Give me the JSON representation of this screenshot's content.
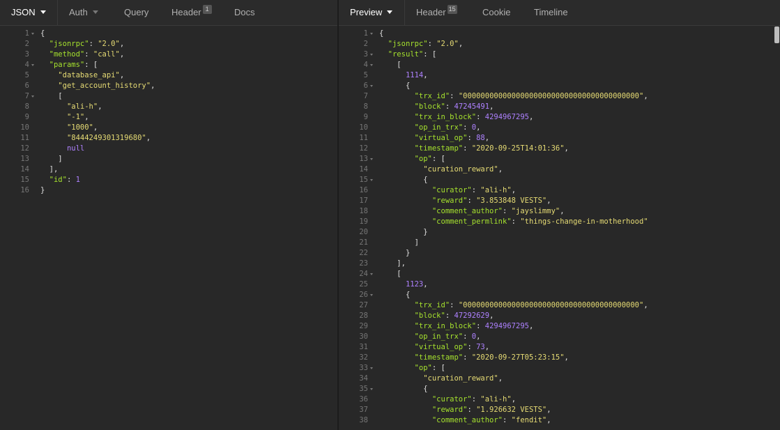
{
  "request_tabs": [
    {
      "label": "JSON",
      "dropdown": true,
      "active": true
    },
    {
      "label": "Auth",
      "dropdown": true
    },
    {
      "label": "Query"
    },
    {
      "label": "Header",
      "badge": "1"
    },
    {
      "label": "Docs"
    }
  ],
  "response_tabs": [
    {
      "label": "Preview",
      "dropdown": true,
      "active": true
    },
    {
      "label": "Header",
      "badge": "15"
    },
    {
      "label": "Cookie"
    },
    {
      "label": "Timeline"
    }
  ],
  "colors": {
    "key": "#a6e22e",
    "string": "#e6db74",
    "number": "#ae81ff",
    "punctuation": "#e0e0e0",
    "line_number": "#767676",
    "background": "#282828"
  },
  "request_lines": [
    {
      "n": "1",
      "fold": true,
      "t": [
        [
          "p",
          "{"
        ]
      ]
    },
    {
      "n": "2",
      "t": [
        [
          "w",
          "  "
        ],
        [
          "k",
          "\"jsonrpc\""
        ],
        [
          "p",
          ": "
        ],
        [
          "s",
          "\"2.0\""
        ],
        [
          "p",
          ","
        ]
      ]
    },
    {
      "n": "3",
      "t": [
        [
          "w",
          "  "
        ],
        [
          "k",
          "\"method\""
        ],
        [
          "p",
          ": "
        ],
        [
          "s",
          "\"call\""
        ],
        [
          "p",
          ","
        ]
      ]
    },
    {
      "n": "4",
      "fold": true,
      "t": [
        [
          "w",
          "  "
        ],
        [
          "k",
          "\"params\""
        ],
        [
          "p",
          ": ["
        ]
      ]
    },
    {
      "n": "5",
      "t": [
        [
          "w",
          "    "
        ],
        [
          "s",
          "\"database_api\""
        ],
        [
          "p",
          ","
        ]
      ]
    },
    {
      "n": "6",
      "t": [
        [
          "w",
          "    "
        ],
        [
          "s",
          "\"get_account_history\""
        ],
        [
          "p",
          ","
        ]
      ]
    },
    {
      "n": "7",
      "fold": true,
      "t": [
        [
          "w",
          "    "
        ],
        [
          "p",
          "["
        ]
      ]
    },
    {
      "n": "8",
      "t": [
        [
          "w",
          "      "
        ],
        [
          "s",
          "\"ali-h\""
        ],
        [
          "p",
          ","
        ]
      ]
    },
    {
      "n": "9",
      "t": [
        [
          "w",
          "      "
        ],
        [
          "s",
          "\"-1\""
        ],
        [
          "p",
          ","
        ]
      ]
    },
    {
      "n": "10",
      "t": [
        [
          "w",
          "      "
        ],
        [
          "s",
          "\"1000\""
        ],
        [
          "p",
          ","
        ]
      ]
    },
    {
      "n": "11",
      "t": [
        [
          "w",
          "      "
        ],
        [
          "s",
          "\"8444249301319680\""
        ],
        [
          "p",
          ","
        ]
      ]
    },
    {
      "n": "12",
      "t": [
        [
          "w",
          "      "
        ],
        [
          "n",
          "null"
        ]
      ]
    },
    {
      "n": "13",
      "t": [
        [
          "w",
          "    "
        ],
        [
          "p",
          "]"
        ]
      ]
    },
    {
      "n": "14",
      "t": [
        [
          "w",
          "  "
        ],
        [
          "p",
          "],"
        ]
      ]
    },
    {
      "n": "15",
      "t": [
        [
          "w",
          "  "
        ],
        [
          "k",
          "\"id\""
        ],
        [
          "p",
          ": "
        ],
        [
          "n",
          "1"
        ]
      ]
    },
    {
      "n": "16",
      "t": [
        [
          "p",
          "}"
        ]
      ]
    }
  ],
  "response_lines": [
    {
      "n": "1",
      "fold": true,
      "t": [
        [
          "p",
          "{"
        ]
      ]
    },
    {
      "n": "2",
      "t": [
        [
          "w",
          "  "
        ],
        [
          "k",
          "\"jsonrpc\""
        ],
        [
          "p",
          ": "
        ],
        [
          "s",
          "\"2.0\""
        ],
        [
          "p",
          ","
        ]
      ]
    },
    {
      "n": "3",
      "fold": true,
      "t": [
        [
          "w",
          "  "
        ],
        [
          "k",
          "\"result\""
        ],
        [
          "p",
          ": ["
        ]
      ]
    },
    {
      "n": "4",
      "fold": true,
      "t": [
        [
          "w",
          "    "
        ],
        [
          "p",
          "["
        ]
      ]
    },
    {
      "n": "5",
      "t": [
        [
          "w",
          "      "
        ],
        [
          "n",
          "1114"
        ],
        [
          "p",
          ","
        ]
      ]
    },
    {
      "n": "6",
      "fold": true,
      "t": [
        [
          "w",
          "      "
        ],
        [
          "p",
          "{"
        ]
      ]
    },
    {
      "n": "7",
      "t": [
        [
          "w",
          "        "
        ],
        [
          "k",
          "\"trx_id\""
        ],
        [
          "p",
          ": "
        ],
        [
          "s",
          "\"0000000000000000000000000000000000000000\""
        ],
        [
          "p",
          ","
        ]
      ]
    },
    {
      "n": "8",
      "t": [
        [
          "w",
          "        "
        ],
        [
          "k",
          "\"block\""
        ],
        [
          "p",
          ": "
        ],
        [
          "n",
          "47245491"
        ],
        [
          "p",
          ","
        ]
      ]
    },
    {
      "n": "9",
      "t": [
        [
          "w",
          "        "
        ],
        [
          "k",
          "\"trx_in_block\""
        ],
        [
          "p",
          ": "
        ],
        [
          "n",
          "4294967295"
        ],
        [
          "p",
          ","
        ]
      ]
    },
    {
      "n": "10",
      "t": [
        [
          "w",
          "        "
        ],
        [
          "k",
          "\"op_in_trx\""
        ],
        [
          "p",
          ": "
        ],
        [
          "n",
          "0"
        ],
        [
          "p",
          ","
        ]
      ]
    },
    {
      "n": "11",
      "t": [
        [
          "w",
          "        "
        ],
        [
          "k",
          "\"virtual_op\""
        ],
        [
          "p",
          ": "
        ],
        [
          "n",
          "88"
        ],
        [
          "p",
          ","
        ]
      ]
    },
    {
      "n": "12",
      "t": [
        [
          "w",
          "        "
        ],
        [
          "k",
          "\"timestamp\""
        ],
        [
          "p",
          ": "
        ],
        [
          "s",
          "\"2020-09-25T14:01:36\""
        ],
        [
          "p",
          ","
        ]
      ]
    },
    {
      "n": "13",
      "fold": true,
      "t": [
        [
          "w",
          "        "
        ],
        [
          "k",
          "\"op\""
        ],
        [
          "p",
          ": ["
        ]
      ]
    },
    {
      "n": "14",
      "t": [
        [
          "w",
          "          "
        ],
        [
          "s",
          "\"curation_reward\""
        ],
        [
          "p",
          ","
        ]
      ]
    },
    {
      "n": "15",
      "fold": true,
      "t": [
        [
          "w",
          "          "
        ],
        [
          "p",
          "{"
        ]
      ]
    },
    {
      "n": "16",
      "t": [
        [
          "w",
          "            "
        ],
        [
          "k",
          "\"curator\""
        ],
        [
          "p",
          ": "
        ],
        [
          "s",
          "\"ali-h\""
        ],
        [
          "p",
          ","
        ]
      ]
    },
    {
      "n": "17",
      "t": [
        [
          "w",
          "            "
        ],
        [
          "k",
          "\"reward\""
        ],
        [
          "p",
          ": "
        ],
        [
          "s",
          "\"3.853848 VESTS\""
        ],
        [
          "p",
          ","
        ]
      ]
    },
    {
      "n": "18",
      "t": [
        [
          "w",
          "            "
        ],
        [
          "k",
          "\"comment_author\""
        ],
        [
          "p",
          ": "
        ],
        [
          "s",
          "\"jayslimmy\""
        ],
        [
          "p",
          ","
        ]
      ]
    },
    {
      "n": "19",
      "t": [
        [
          "w",
          "            "
        ],
        [
          "k",
          "\"comment_permlink\""
        ],
        [
          "p",
          ": "
        ],
        [
          "s",
          "\"things-change-in-motherhood\""
        ]
      ]
    },
    {
      "n": "20",
      "t": [
        [
          "w",
          "          "
        ],
        [
          "p",
          "}"
        ]
      ]
    },
    {
      "n": "21",
      "t": [
        [
          "w",
          "        "
        ],
        [
          "p",
          "]"
        ]
      ]
    },
    {
      "n": "22",
      "t": [
        [
          "w",
          "      "
        ],
        [
          "p",
          "}"
        ]
      ]
    },
    {
      "n": "23",
      "t": [
        [
          "w",
          "    "
        ],
        [
          "p",
          "],"
        ]
      ]
    },
    {
      "n": "24",
      "fold": true,
      "t": [
        [
          "w",
          "    "
        ],
        [
          "p",
          "["
        ]
      ]
    },
    {
      "n": "25",
      "t": [
        [
          "w",
          "      "
        ],
        [
          "n",
          "1123"
        ],
        [
          "p",
          ","
        ]
      ]
    },
    {
      "n": "26",
      "fold": true,
      "t": [
        [
          "w",
          "      "
        ],
        [
          "p",
          "{"
        ]
      ]
    },
    {
      "n": "27",
      "t": [
        [
          "w",
          "        "
        ],
        [
          "k",
          "\"trx_id\""
        ],
        [
          "p",
          ": "
        ],
        [
          "s",
          "\"0000000000000000000000000000000000000000\""
        ],
        [
          "p",
          ","
        ]
      ]
    },
    {
      "n": "28",
      "t": [
        [
          "w",
          "        "
        ],
        [
          "k",
          "\"block\""
        ],
        [
          "p",
          ": "
        ],
        [
          "n",
          "47292629"
        ],
        [
          "p",
          ","
        ]
      ]
    },
    {
      "n": "29",
      "t": [
        [
          "w",
          "        "
        ],
        [
          "k",
          "\"trx_in_block\""
        ],
        [
          "p",
          ": "
        ],
        [
          "n",
          "4294967295"
        ],
        [
          "p",
          ","
        ]
      ]
    },
    {
      "n": "30",
      "t": [
        [
          "w",
          "        "
        ],
        [
          "k",
          "\"op_in_trx\""
        ],
        [
          "p",
          ": "
        ],
        [
          "n",
          "0"
        ],
        [
          "p",
          ","
        ]
      ]
    },
    {
      "n": "31",
      "t": [
        [
          "w",
          "        "
        ],
        [
          "k",
          "\"virtual_op\""
        ],
        [
          "p",
          ": "
        ],
        [
          "n",
          "73"
        ],
        [
          "p",
          ","
        ]
      ]
    },
    {
      "n": "32",
      "t": [
        [
          "w",
          "        "
        ],
        [
          "k",
          "\"timestamp\""
        ],
        [
          "p",
          ": "
        ],
        [
          "s",
          "\"2020-09-27T05:23:15\""
        ],
        [
          "p",
          ","
        ]
      ]
    },
    {
      "n": "33",
      "fold": true,
      "t": [
        [
          "w",
          "        "
        ],
        [
          "k",
          "\"op\""
        ],
        [
          "p",
          ": ["
        ]
      ]
    },
    {
      "n": "34",
      "t": [
        [
          "w",
          "          "
        ],
        [
          "s",
          "\"curation_reward\""
        ],
        [
          "p",
          ","
        ]
      ]
    },
    {
      "n": "35",
      "fold": true,
      "t": [
        [
          "w",
          "          "
        ],
        [
          "p",
          "{"
        ]
      ]
    },
    {
      "n": "36",
      "t": [
        [
          "w",
          "            "
        ],
        [
          "k",
          "\"curator\""
        ],
        [
          "p",
          ": "
        ],
        [
          "s",
          "\"ali-h\""
        ],
        [
          "p",
          ","
        ]
      ]
    },
    {
      "n": "37",
      "t": [
        [
          "w",
          "            "
        ],
        [
          "k",
          "\"reward\""
        ],
        [
          "p",
          ": "
        ],
        [
          "s",
          "\"1.926632 VESTS\""
        ],
        [
          "p",
          ","
        ]
      ]
    },
    {
      "n": "38",
      "t": [
        [
          "w",
          "            "
        ],
        [
          "k",
          "\"comment_author\""
        ],
        [
          "p",
          ": "
        ],
        [
          "s",
          "\"fendit\""
        ],
        [
          "p",
          ","
        ]
      ]
    }
  ]
}
